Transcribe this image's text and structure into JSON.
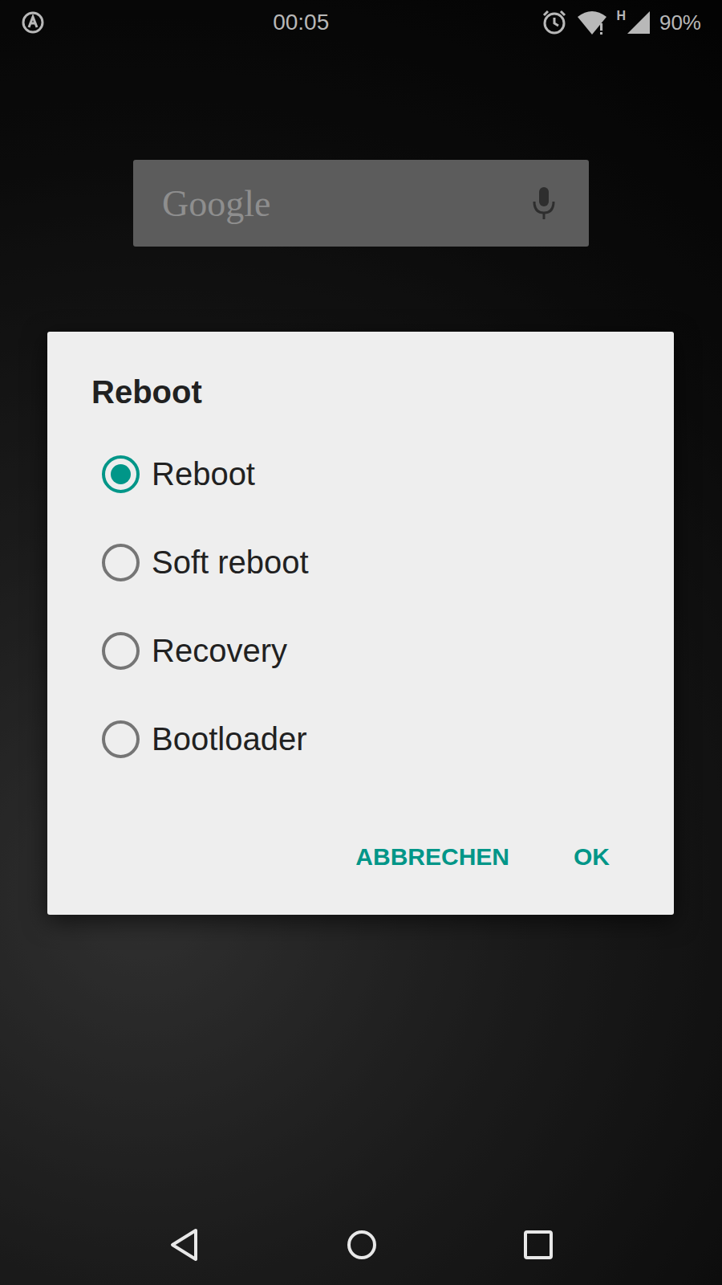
{
  "status_bar": {
    "time": "00:05",
    "network": "H",
    "battery": "90%"
  },
  "search": {
    "placeholder": "Google"
  },
  "dialog": {
    "title": "Reboot",
    "options": [
      {
        "label": "Reboot",
        "selected": true
      },
      {
        "label": "Soft reboot",
        "selected": false
      },
      {
        "label": "Recovery",
        "selected": false
      },
      {
        "label": "Bootloader",
        "selected": false
      }
    ],
    "buttons": [
      "ABBRECHEN",
      "OK"
    ]
  }
}
